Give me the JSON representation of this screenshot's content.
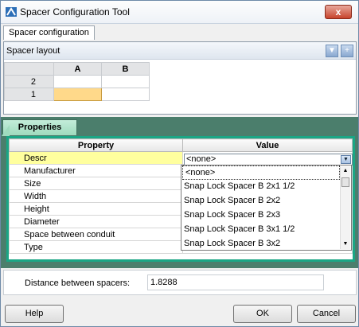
{
  "window": {
    "title": "Spacer Configuration Tool",
    "close_glyph": "x"
  },
  "tabs": {
    "spacer_configuration": "Spacer configuration"
  },
  "layout": {
    "title": "Spacer layout",
    "columns": [
      "A",
      "B"
    ],
    "rows": [
      "2",
      "1"
    ],
    "selected_cell": "A1"
  },
  "properties": {
    "tab_label": "Properties",
    "headers": {
      "property": "Property",
      "value": "Value"
    },
    "rows": [
      {
        "name": "Descr",
        "value": "<none>"
      },
      {
        "name": "Manufacturer",
        "value": ""
      },
      {
        "name": "Size",
        "value": ""
      },
      {
        "name": "Width",
        "value": ""
      },
      {
        "name": "Height",
        "value": ""
      },
      {
        "name": "Diameter",
        "value": ""
      },
      {
        "name": "Space between conduit",
        "value": ""
      },
      {
        "name": "Type",
        "value": ""
      }
    ],
    "dropdown_options": [
      "<none>",
      "Snap Lock Spacer B 2x1 1/2",
      "Snap Lock Spacer B 2x2",
      "Snap Lock Spacer B 2x3",
      "Snap Lock Spacer B 3x1 1/2",
      "Snap Lock Spacer B 3x2"
    ],
    "dropdown_selected": "<none>"
  },
  "distance": {
    "label": "Distance between spacers:",
    "value": "1.8288"
  },
  "buttons": {
    "help": "Help",
    "ok": "OK",
    "cancel": "Cancel"
  },
  "colors": {
    "accent": "#1aa685",
    "selected_cell": "#ffd98a",
    "selected_row": "#ffff9e"
  }
}
